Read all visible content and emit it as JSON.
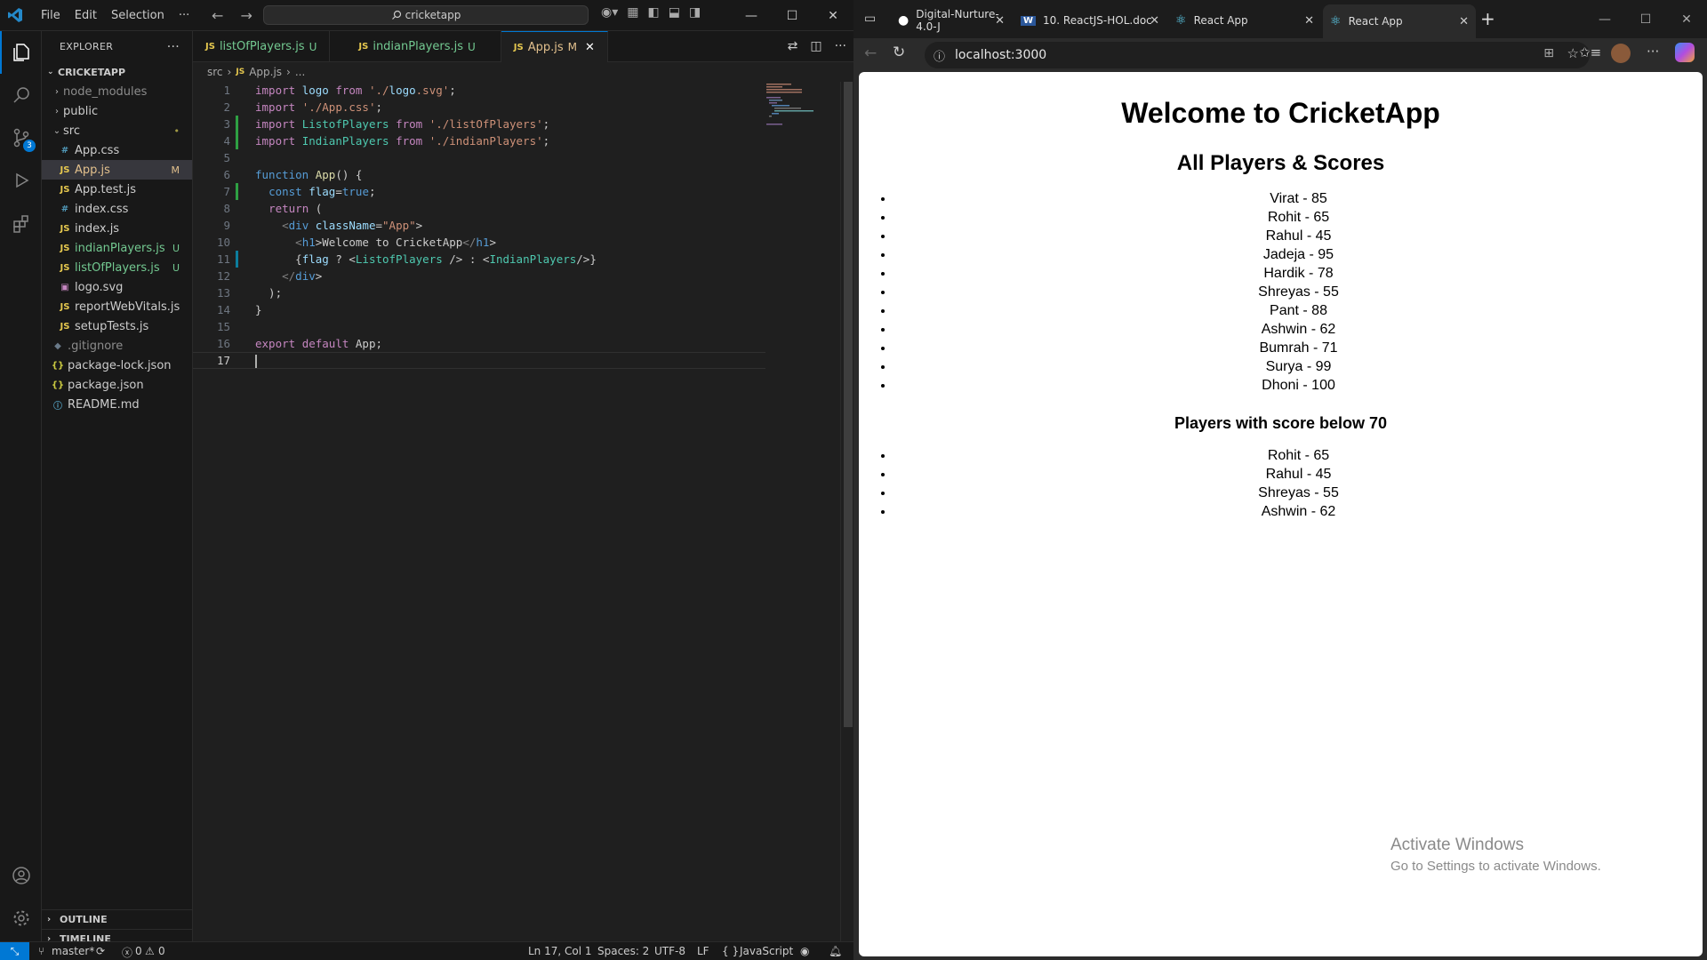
{
  "vscode": {
    "menu": [
      "File",
      "Edit",
      "Selection",
      "···"
    ],
    "search": "cricketapp",
    "explorer_title": "EXPLORER",
    "project": "CRICKETAPP",
    "tree": [
      {
        "name": "node_modules",
        "kind": "folder",
        "badge": ""
      },
      {
        "name": "public",
        "kind": "folder",
        "badge": ""
      },
      {
        "name": "src",
        "kind": "folder-open",
        "badge": "•"
      },
      {
        "name": "App.css",
        "kind": "css",
        "badge": ""
      },
      {
        "name": "App.js",
        "kind": "js",
        "badge": "M"
      },
      {
        "name": "App.test.js",
        "kind": "js",
        "badge": ""
      },
      {
        "name": "index.css",
        "kind": "css",
        "badge": ""
      },
      {
        "name": "index.js",
        "kind": "js",
        "badge": ""
      },
      {
        "name": "indianPlayers.js",
        "kind": "js",
        "badge": "U"
      },
      {
        "name": "listOfPlayers.js",
        "kind": "js",
        "badge": "U"
      },
      {
        "name": "logo.svg",
        "kind": "svg",
        "badge": ""
      },
      {
        "name": "reportWebVitals.js",
        "kind": "js",
        "badge": ""
      },
      {
        "name": "setupTests.js",
        "kind": "js",
        "badge": ""
      },
      {
        "name": ".gitignore",
        "kind": "git",
        "badge": ""
      },
      {
        "name": "package-lock.json",
        "kind": "json",
        "badge": ""
      },
      {
        "name": "package.json",
        "kind": "json",
        "badge": ""
      },
      {
        "name": "README.md",
        "kind": "info",
        "badge": ""
      }
    ],
    "outline": "OUTLINE",
    "timeline": "TIMELINE",
    "scm_count": "3",
    "tabs": [
      {
        "label": "listOfPlayers.js",
        "status": "U"
      },
      {
        "label": "indianPlayers.js",
        "status": "U"
      },
      {
        "label": "App.js",
        "status": "M"
      }
    ],
    "breadcrumb": [
      "src",
      "App.js",
      "..."
    ],
    "code": [
      "import logo from './logo.svg';",
      "import './App.css';",
      "import ListofPlayers from './listOfPlayers';",
      "import IndianPlayers from './indianPlayers';",
      "",
      "function App() {",
      "  const flag=true;",
      "  return (",
      "    <div className=\"App\">",
      "      <h1>Welcome to CricketApp</h1>",
      "      {flag ? <ListofPlayers /> : <IndianPlayers/>}",
      "    </div>",
      "  );",
      "}",
      "",
      "export default App;",
      ""
    ],
    "status": {
      "branch": "master*",
      "errors": "0",
      "warnings": "0",
      "position": "Ln 17, Col 1",
      "spaces": "Spaces: 2",
      "encoding": "UTF-8",
      "eol": "LF",
      "language": "JavaScript"
    }
  },
  "browser": {
    "tabs": [
      "Digital-Nurture-4.0-J",
      "10. ReactJS-HOL.doc",
      "React App",
      "React App"
    ],
    "url": "localhost:3000",
    "page": {
      "title": "Welcome to CricketApp",
      "all_heading": "All Players & Scores",
      "all_players": [
        "Virat - 85",
        "Rohit - 65",
        "Rahul - 45",
        "Jadeja - 95",
        "Hardik - 78",
        "Shreyas - 55",
        "Pant - 88",
        "Ashwin - 62",
        "Bumrah - 71",
        "Surya - 99",
        "Dhoni - 100"
      ],
      "below_heading": "Players with score below 70",
      "below_players": [
        "Rohit - 65",
        "Rahul - 45",
        "Shreyas - 55",
        "Ashwin - 62"
      ]
    },
    "watermark_title": "Activate Windows",
    "watermark_sub": "Go to Settings to activate Windows."
  }
}
